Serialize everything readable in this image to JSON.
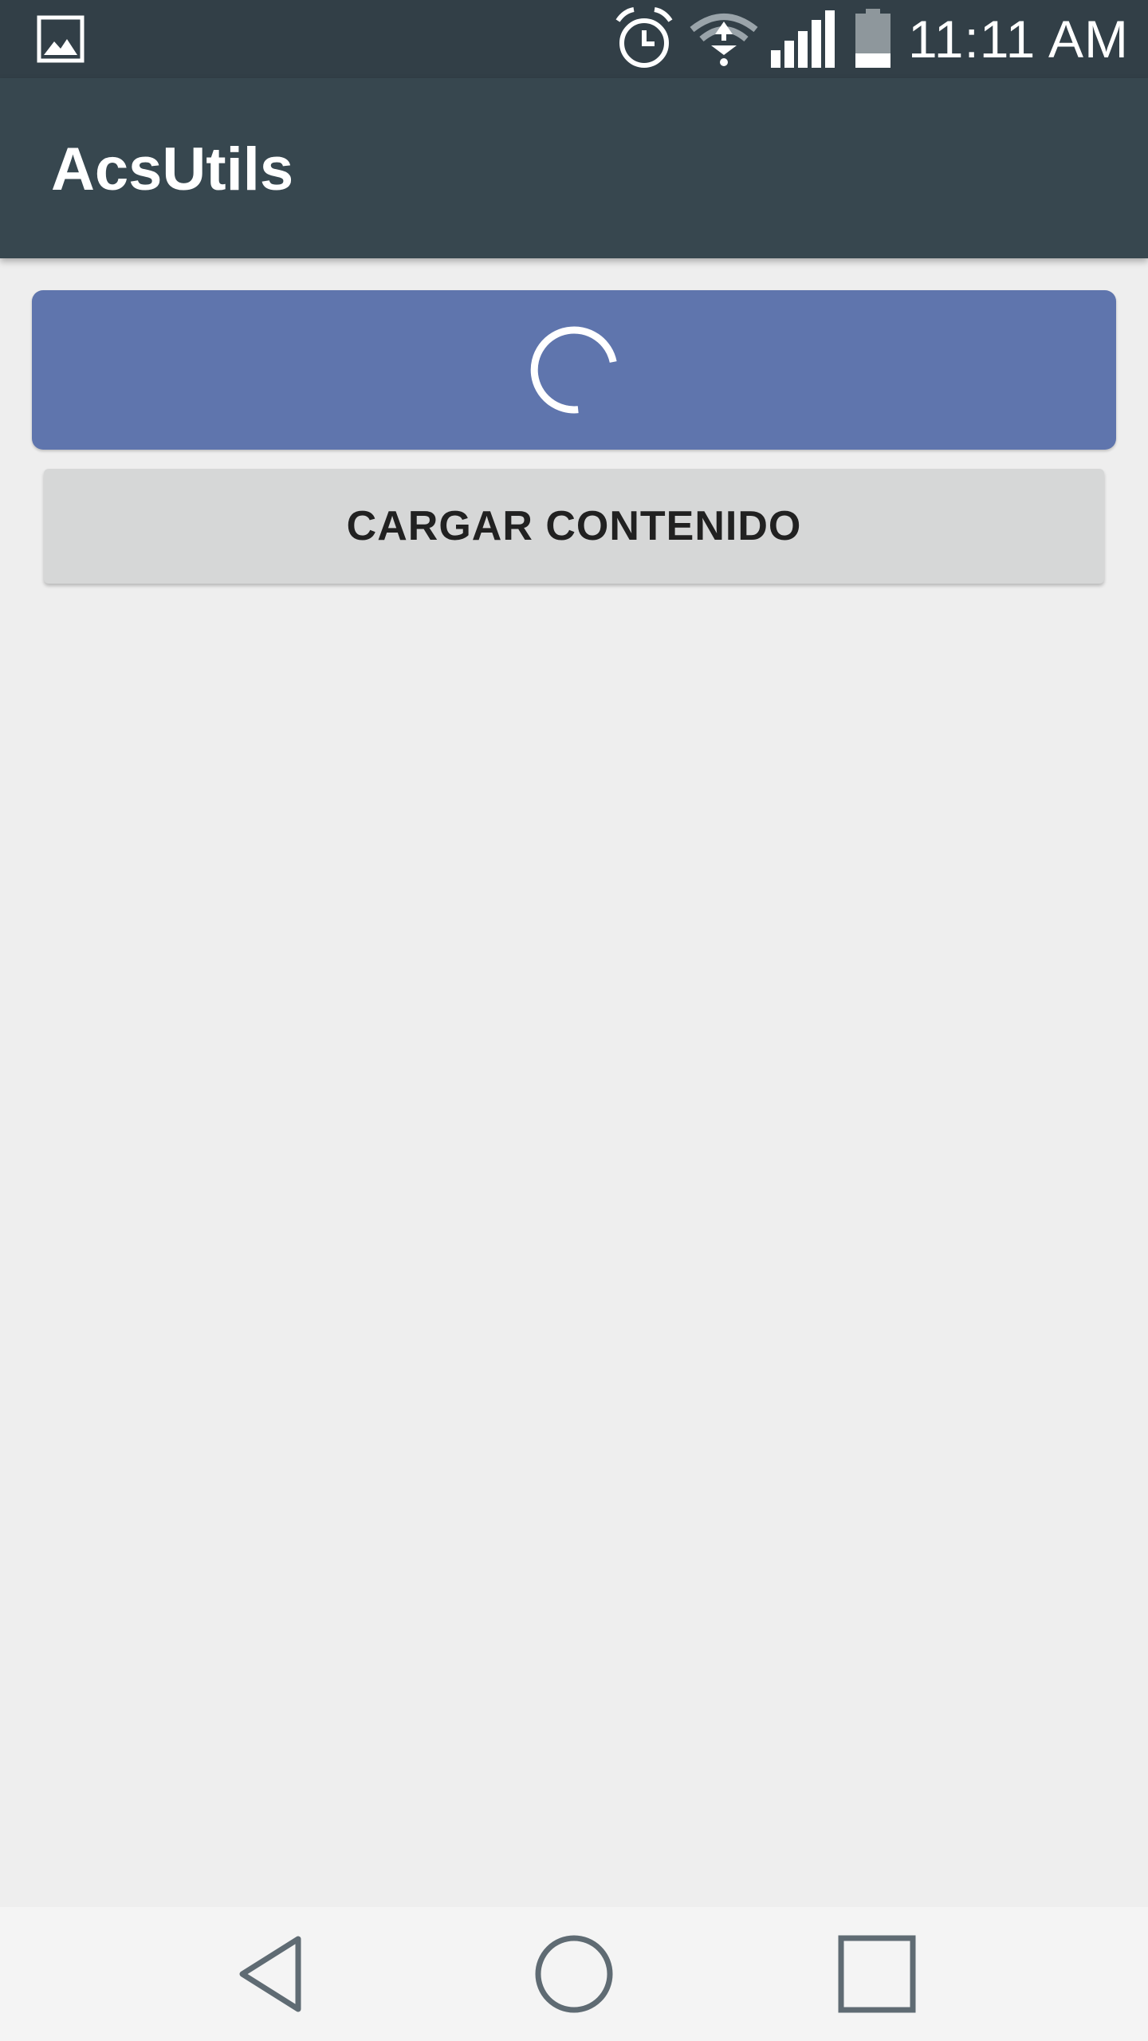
{
  "status_bar": {
    "time": "11:11 AM",
    "icons": [
      "gallery-icon",
      "alarm-icon",
      "wifi-icon",
      "signal-icon",
      "battery-icon"
    ],
    "background": "#323f47"
  },
  "app_bar": {
    "title": "AcsUtils",
    "background": "#37474f"
  },
  "loading_button": {
    "state": "loading",
    "icon": "spinner-icon",
    "color": "#5f75ad"
  },
  "load_button": {
    "label": "CARGAR CONTENIDO",
    "color": "#d6d7d7"
  },
  "nav_bar": {
    "items": [
      "back-icon",
      "home-icon",
      "recent-apps-icon"
    ],
    "icon_color": "#5f6b73"
  }
}
